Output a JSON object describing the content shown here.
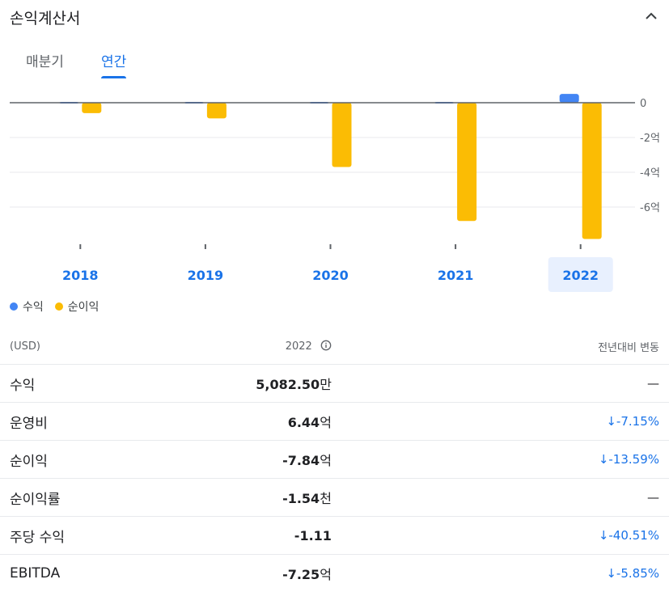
{
  "header": {
    "title": "손익계산서"
  },
  "tabs": [
    {
      "label": "매분기",
      "active": false
    },
    {
      "label": "연간",
      "active": true
    }
  ],
  "colors": {
    "revenue": "#4285f4",
    "net_income": "#fbbc04",
    "accent": "#1a73e8"
  },
  "chart_data": {
    "type": "bar",
    "categories": [
      "2018",
      "2019",
      "2020",
      "2021",
      "2022"
    ],
    "selected_category": "2022",
    "series": [
      {
        "name": "수익",
        "values": [
          0.001,
          0.001,
          0.001,
          0.0001,
          0.508
        ]
      },
      {
        "name": "순이익",
        "values": [
          -0.6,
          -0.9,
          -3.7,
          -6.8,
          -7.84
        ]
      }
    ],
    "y_ticks": [
      {
        "value": 0,
        "label": "0"
      },
      {
        "value": -2,
        "label": "-2억"
      },
      {
        "value": -4,
        "label": "-4억"
      },
      {
        "value": -6,
        "label": "-6억"
      }
    ],
    "ylim": [
      -8,
      0
    ],
    "legend_position": "bottom-left",
    "grid": true
  },
  "legend": [
    {
      "label": "수익",
      "color": "#4285f4"
    },
    {
      "label": "순이익",
      "color": "#fbbc04"
    }
  ],
  "table": {
    "currency_header": "(USD)",
    "year_header": "2022",
    "change_header": "전년대비 변동",
    "rows": [
      {
        "label": "수익",
        "value": "5,082.50",
        "unit": "만",
        "change": "—",
        "trend": "none"
      },
      {
        "label": "운영비",
        "value": "6.44",
        "unit": "억",
        "change": "-7.15%",
        "trend": "down"
      },
      {
        "label": "순이익",
        "value": "-7.84",
        "unit": "억",
        "change": "-13.59%",
        "trend": "down"
      },
      {
        "label": "순이익률",
        "value": "-1.54",
        "unit": "천",
        "change": "—",
        "trend": "none"
      },
      {
        "label": "주당 수익",
        "value": "-1.11",
        "unit": "",
        "change": "-40.51%",
        "trend": "down"
      },
      {
        "label": "EBITDA",
        "value": "-7.25",
        "unit": "억",
        "change": "-5.85%",
        "trend": "down"
      }
    ]
  }
}
